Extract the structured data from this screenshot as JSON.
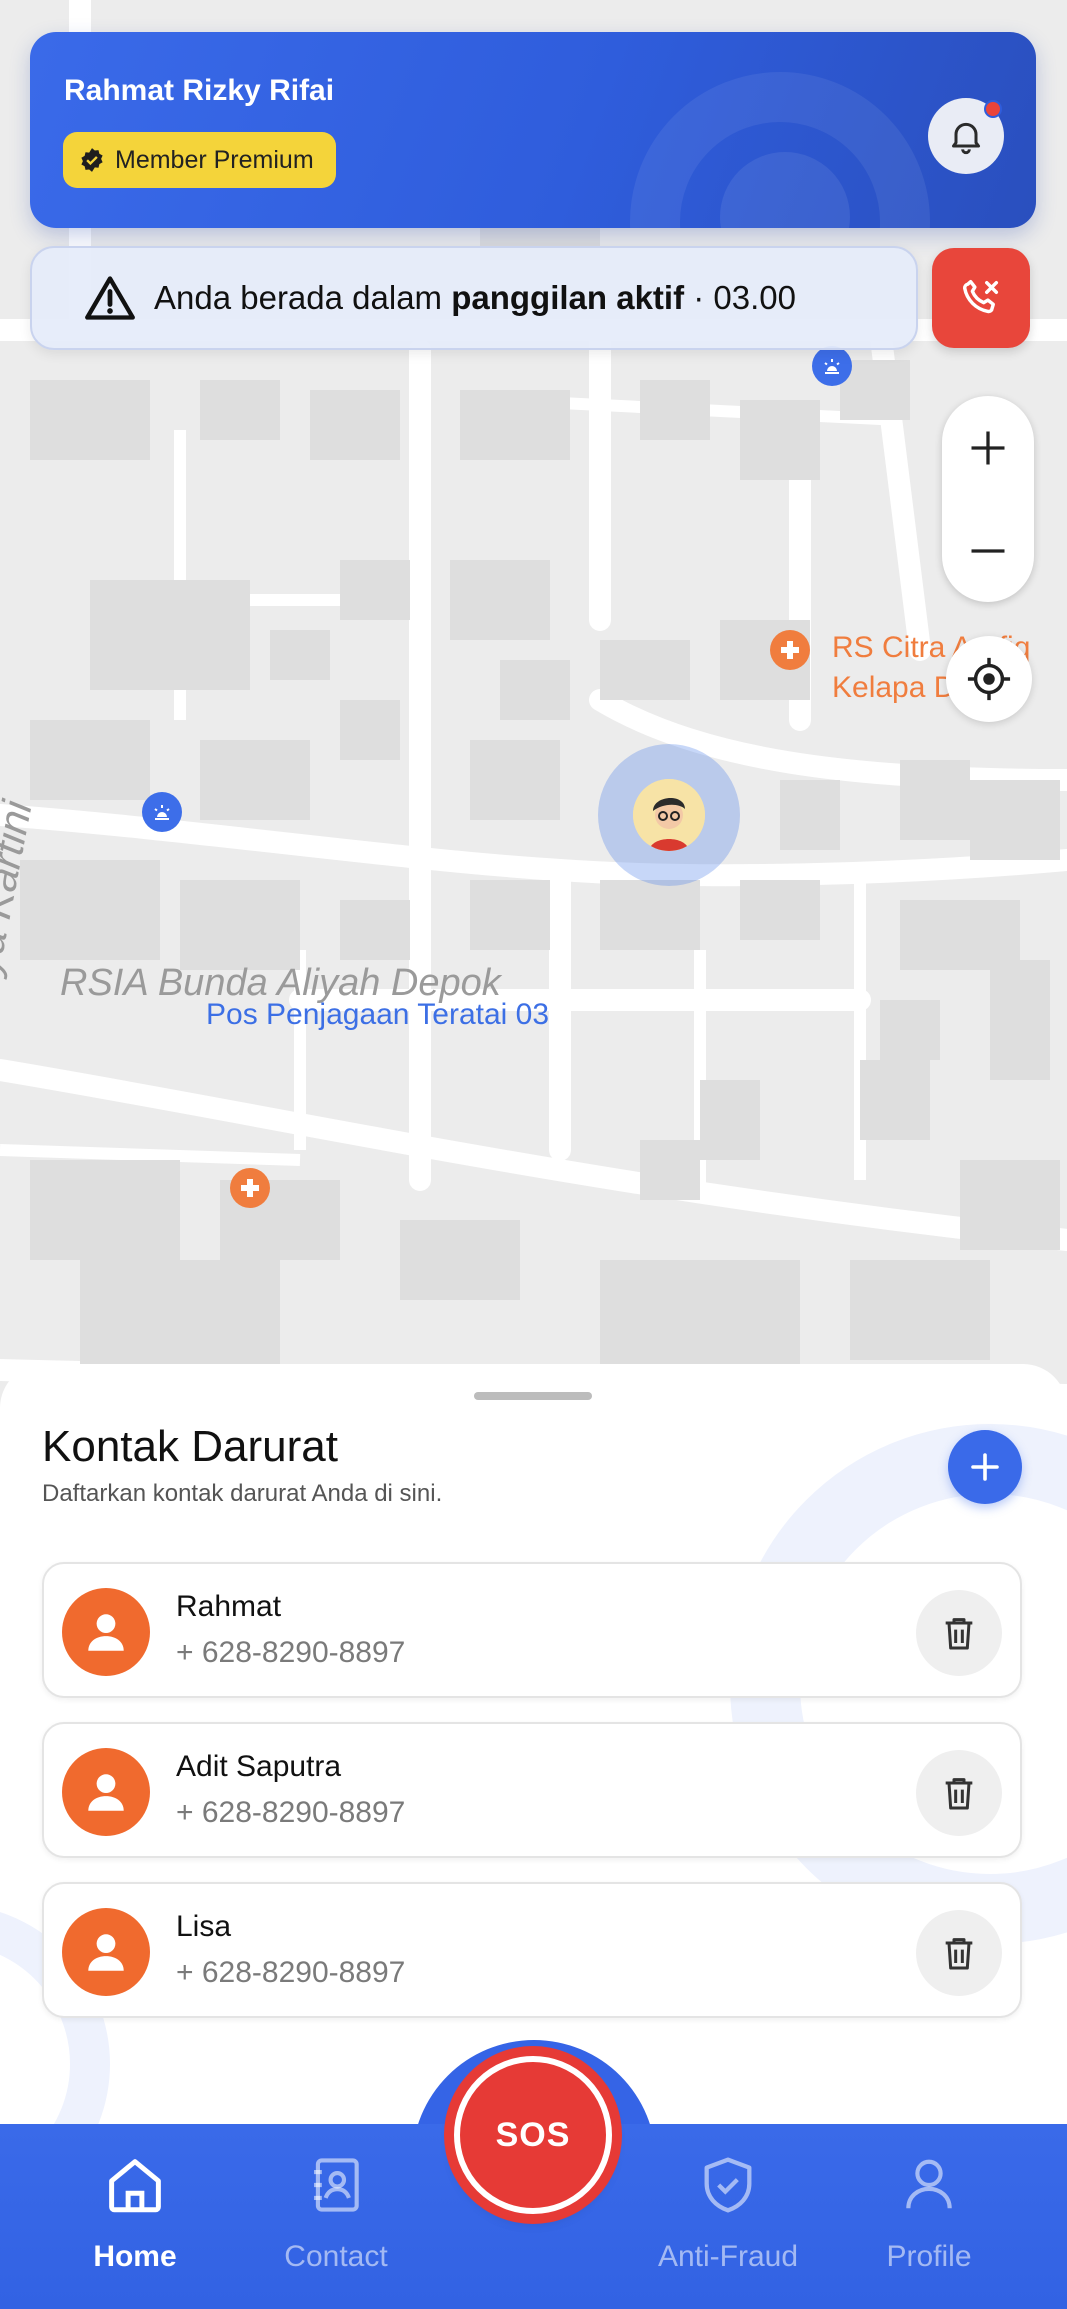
{
  "header": {
    "user_name": "Rahmat Rizky Rifai",
    "member_badge": "Member Premium",
    "notification_dot": true
  },
  "call_banner": {
    "text_prefix": "Anda berada dalam ",
    "text_bold": "panggilan aktif",
    "text_suffix": " · 03.00"
  },
  "map": {
    "labels": {
      "hospital": "RS Citra Arafiq Kelapa Dua",
      "rsia": "RSIA Bunda Aliyah Depok",
      "pos": "Pos Penjagaan Teratai 03",
      "street": "Jl. Raya Kartini"
    }
  },
  "sheet": {
    "title": "Kontak Darurat",
    "subtitle": "Daftarkan kontak darurat Anda di sini.",
    "contacts": [
      {
        "name": "Rahmat",
        "phone": "+ 628-8290-8897"
      },
      {
        "name": "Adit Saputra",
        "phone": "+ 628-8290-8897"
      },
      {
        "name": "Lisa",
        "phone": "+ 628-8290-8897"
      }
    ]
  },
  "nav": {
    "home": "Home",
    "contact": "Contact",
    "sos": "SOS",
    "anti_fraud": "Anti-Fraud",
    "profile": "Profile",
    "active": "home"
  },
  "colors": {
    "primary": "#3a6ae9",
    "danger": "#e63a36",
    "badge": "#f4d43a",
    "avatar": "#f06a2e"
  }
}
